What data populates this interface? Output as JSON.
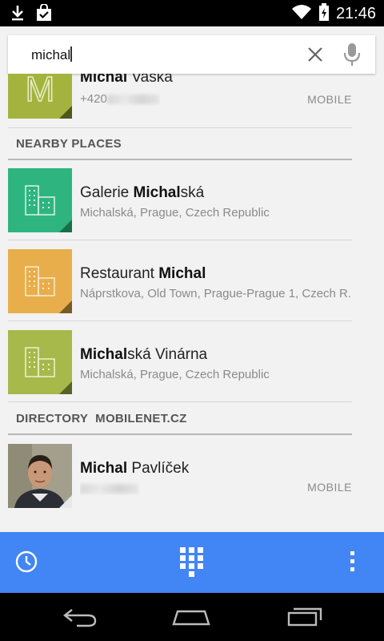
{
  "status_bar": {
    "time": "21:46",
    "icons": [
      "download-icon",
      "shopping-bag-icon",
      "wifi-icon",
      "battery-icon"
    ]
  },
  "search": {
    "query": "michal",
    "clear_icon": "close-icon",
    "voice_icon": "microphone-icon"
  },
  "contacts": [
    {
      "name_bold": "Michal",
      "name_rest": " Vaška",
      "phone_visible": "+420",
      "type": "MOBILE",
      "tile_color": "#a4b33e",
      "tile_letter": "M"
    }
  ],
  "nearby_places": {
    "header": "NEARBY PLACES",
    "items": [
      {
        "name_pre": "Galerie ",
        "name_bold": "Michal",
        "name_post": "ská",
        "address": "Michalská, Prague, Czech Republic",
        "tile_color": "#2eb57f"
      },
      {
        "name_pre": "Restaurant ",
        "name_bold": "Michal",
        "name_post": "",
        "address": "Náprstkova, Old Town, Prague-Prague 1, Czech R..",
        "tile_color": "#e8ae4b"
      },
      {
        "name_pre": "",
        "name_bold": "Michal",
        "name_post": "ská Vinárna",
        "address": "Michalská, Prague, Czech Republic",
        "tile_color": "#a6b94a"
      }
    ]
  },
  "directory": {
    "header_label": "DIRECTORY",
    "header_source": "MOBILENET.CZ",
    "items": [
      {
        "name_bold": "Michal",
        "name_rest": " Pavlíček",
        "type": "MOBILE"
      }
    ]
  },
  "action_bar": {
    "icons": [
      "history-icon",
      "dialpad-icon",
      "overflow-menu-icon"
    ],
    "color": "#4285f4"
  },
  "nav_bar": {
    "icons": [
      "back-icon",
      "home-icon",
      "recents-icon"
    ]
  }
}
